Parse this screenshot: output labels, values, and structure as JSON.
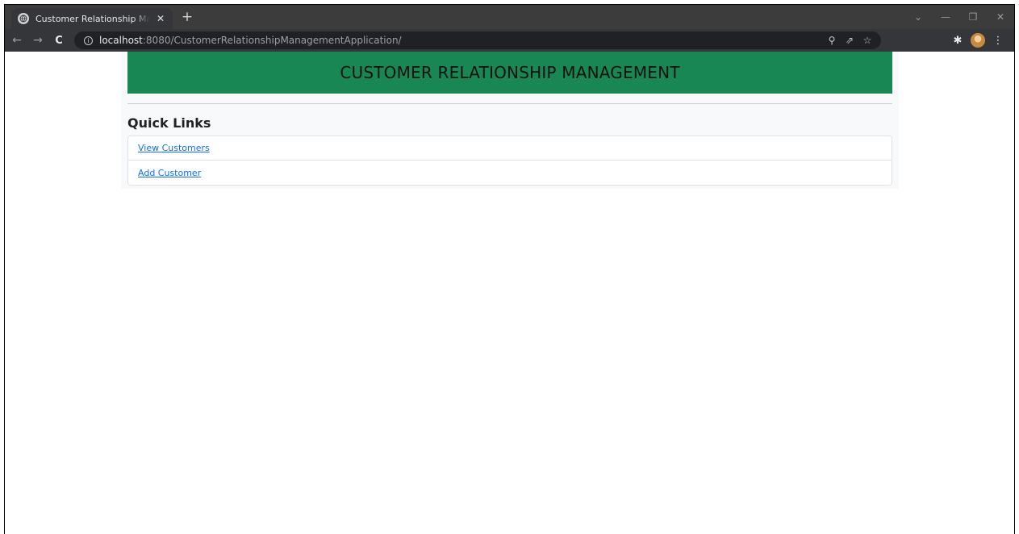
{
  "browser": {
    "tab_title": "Customer Relationship Management Application",
    "tab_close": "✕",
    "new_tab": "+",
    "url_host": "localhost",
    "url_rest": ":8080/CustomerRelationshipManagementApplication/",
    "icons": {
      "favicon": "globe-icon",
      "back": "back-arrow-icon",
      "forward": "forward-arrow-icon",
      "reload": "reload-icon",
      "info": "info-icon",
      "zoom": "zoom-icon",
      "share": "share-icon",
      "bookmark": "star-icon",
      "extensions": "puzzle-icon",
      "profile": "avatar",
      "menu": "kebab-menu-icon"
    }
  },
  "page": {
    "header_title": "CUSTOMER RELATIONSHIP MANAGEMENT",
    "section_title": "Quick Links",
    "links": [
      {
        "label": "View Customers"
      },
      {
        "label": "Add Customer"
      }
    ]
  },
  "colors": {
    "header_bg": "#198754",
    "link": "#0d6efd",
    "chrome_dark": "#35363a"
  }
}
